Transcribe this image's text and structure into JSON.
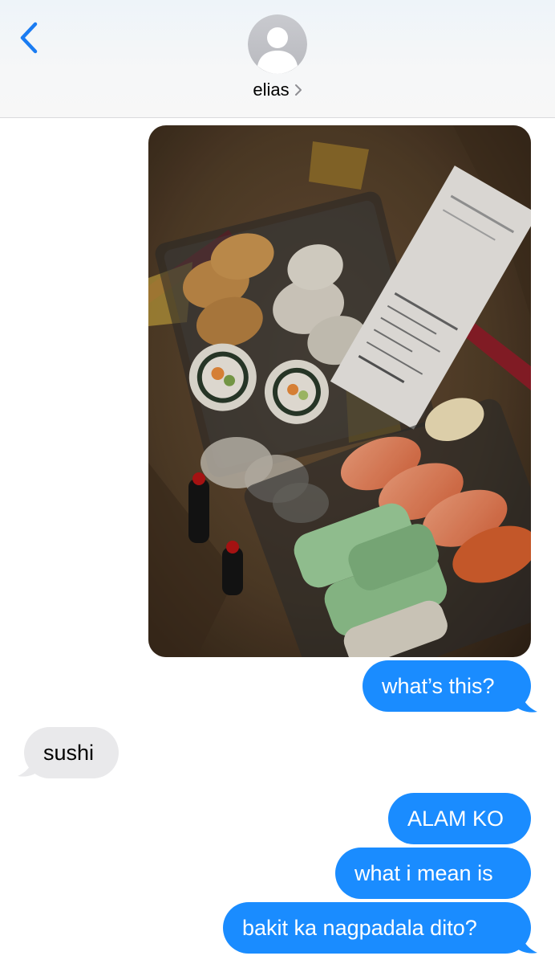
{
  "header": {
    "contact_name": "elias"
  },
  "icons": {
    "back": "chevron-left-icon",
    "avatar": "person-silhouette-icon",
    "contact_disclosure": "chevron-right-icon"
  },
  "messages": [
    {
      "from": "me",
      "type": "photo"
    },
    {
      "from": "me",
      "type": "text",
      "text": "what’s this?"
    },
    {
      "from": "them",
      "type": "text",
      "text": "sushi"
    },
    {
      "from": "me",
      "type": "text",
      "text": "ALAM KO"
    },
    {
      "from": "me",
      "type": "text",
      "text": "what i mean is"
    },
    {
      "from": "me",
      "type": "text",
      "text": "bakit ka nagpadala dito?"
    }
  ],
  "colors": {
    "sent_bubble": "#1a8cff",
    "received_bubble": "#e9e9eb",
    "accent": "#1a7cf2"
  }
}
